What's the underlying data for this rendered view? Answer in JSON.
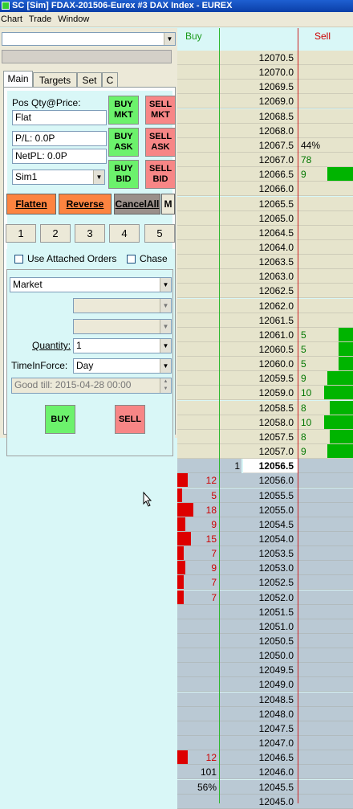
{
  "window": {
    "title": "SC [Sim] FDAX-201506-Eurex  #3  DAX Index - EUREX",
    "menu": [
      "Chart",
      "Trade",
      "Window"
    ]
  },
  "panel": {
    "tabs": [
      "Main",
      "Targets",
      "Set",
      "C"
    ],
    "pos_label": "Pos Qty@Price:",
    "pos_value": "Flat",
    "pl_value": "P/L: 0.0P",
    "netpl_value": "NetPL: 0.0P",
    "account": "Sim1",
    "buttons": {
      "buy_mkt": [
        "BUY",
        "MKT"
      ],
      "sell_mkt": [
        "SELL",
        "MKT"
      ],
      "buy_ask": [
        "BUY",
        "ASK"
      ],
      "sell_ask": [
        "SELL",
        "ASK"
      ],
      "buy_bid": [
        "BUY",
        "BID"
      ],
      "sell_bid": [
        "SELL",
        "BID"
      ],
      "flatten": "Flatten",
      "reverse": "Reverse",
      "cancel_all": "CancelAll",
      "m": "M",
      "buy": "BUY",
      "sell": "SELL"
    },
    "qty_presets": [
      "1",
      "2",
      "3",
      "4",
      "5"
    ],
    "use_attached_orders": "Use Attached Orders",
    "chase": "Chase",
    "order_type": "Market",
    "quantity_label": "Quantity:",
    "quantity_value": "1",
    "tif_label": "TimeInForce:",
    "tif_value": "Day",
    "good_till": "Good till: 2015-04-28 00:00"
  },
  "ladder": {
    "buy_header": "Buy",
    "sell_header": "Sell",
    "colors": {
      "ask_bg": "#e6e4cc",
      "bid_bg": "#bac9d4",
      "buy_line": "#2eb82e",
      "sell_line": "#cc2222",
      "ask_bar": "#00b400",
      "bid_bar": "#dd0000",
      "ask_text": "#007700",
      "bid_text": "#cc0000"
    },
    "last": {
      "qty": "1",
      "price": "12056.5"
    },
    "asks": [
      {
        "price": "12070.5",
        "sell": ""
      },
      {
        "price": "12070.0",
        "sell": ""
      },
      {
        "price": "12069.5",
        "sell": ""
      },
      {
        "price": "12069.0",
        "sell": ""
      },
      {
        "price": "12068.5",
        "sell": ""
      },
      {
        "price": "12068.0",
        "sell": ""
      },
      {
        "price": "12067.5",
        "sell": "44%"
      },
      {
        "price": "12067.0",
        "sell": "78"
      },
      {
        "price": "12066.5",
        "sell": "9"
      },
      {
        "price": "12066.0",
        "sell": ""
      },
      {
        "price": "12065.5",
        "sell": ""
      },
      {
        "price": "12065.0",
        "sell": ""
      },
      {
        "price": "12064.5",
        "sell": ""
      },
      {
        "price": "12064.0",
        "sell": ""
      },
      {
        "price": "12063.5",
        "sell": ""
      },
      {
        "price": "12063.0",
        "sell": ""
      },
      {
        "price": "12062.5",
        "sell": ""
      },
      {
        "price": "12062.0",
        "sell": ""
      },
      {
        "price": "12061.5",
        "sell": ""
      },
      {
        "price": "12061.0",
        "sell": "5"
      },
      {
        "price": "12060.5",
        "sell": "5"
      },
      {
        "price": "12060.0",
        "sell": "5"
      },
      {
        "price": "12059.5",
        "sell": "9"
      },
      {
        "price": "12059.0",
        "sell": "10"
      },
      {
        "price": "12058.5",
        "sell": "8"
      },
      {
        "price": "12058.0",
        "sell": "10"
      },
      {
        "price": "12057.5",
        "sell": "8"
      },
      {
        "price": "12057.0",
        "sell": "9"
      }
    ],
    "bids": [
      {
        "price": "12056.0",
        "buy": "12"
      },
      {
        "price": "12055.5",
        "buy": "5"
      },
      {
        "price": "12055.0",
        "buy": "18"
      },
      {
        "price": "12054.5",
        "buy": "9"
      },
      {
        "price": "12054.0",
        "buy": "15"
      },
      {
        "price": "12053.5",
        "buy": "7"
      },
      {
        "price": "12053.0",
        "buy": "9"
      },
      {
        "price": "12052.5",
        "buy": "7"
      },
      {
        "price": "12052.0",
        "buy": "7"
      },
      {
        "price": "12051.5",
        "buy": ""
      },
      {
        "price": "12051.0",
        "buy": ""
      },
      {
        "price": "12050.5",
        "buy": ""
      },
      {
        "price": "12050.0",
        "buy": ""
      },
      {
        "price": "12049.5",
        "buy": ""
      },
      {
        "price": "12049.0",
        "buy": ""
      },
      {
        "price": "12048.5",
        "buy": ""
      },
      {
        "price": "12048.0",
        "buy": ""
      },
      {
        "price": "12047.5",
        "buy": ""
      },
      {
        "price": "12047.0",
        "buy": ""
      },
      {
        "price": "12046.5",
        "buy": "12"
      },
      {
        "price": "12046.0",
        "buy": "101"
      },
      {
        "price": "12045.5",
        "buy": "56%"
      },
      {
        "price": "12045.0",
        "buy": ""
      }
    ]
  }
}
